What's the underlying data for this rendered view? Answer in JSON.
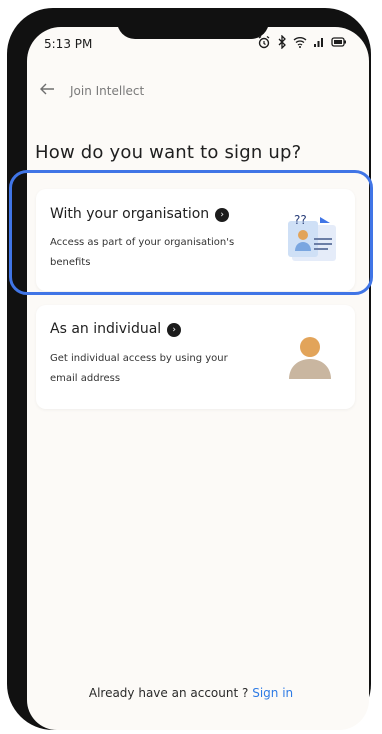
{
  "status_bar": {
    "time": "5:13 PM",
    "icons": [
      "alarm-icon",
      "bluetooth-icon",
      "wifi-icon",
      "signal-icon",
      "battery-icon"
    ]
  },
  "header": {
    "back_label": "Join Intellect"
  },
  "page": {
    "title": "How do you want to sign up?"
  },
  "options": [
    {
      "title": "With your organisation",
      "description": "Access as part of your organisation's benefits",
      "highlighted": true
    },
    {
      "title": "As an individual",
      "description": "Get individual access by using your email address",
      "highlighted": false
    }
  ],
  "footer": {
    "prompt": "Already have an account ?",
    "signin_label": "Sign in"
  },
  "colors": {
    "accent": "#4075e6",
    "link": "#2e7be5",
    "background": "#fcfaf7",
    "person_head": "#e2a45a",
    "person_body": "#c9b6a0"
  }
}
